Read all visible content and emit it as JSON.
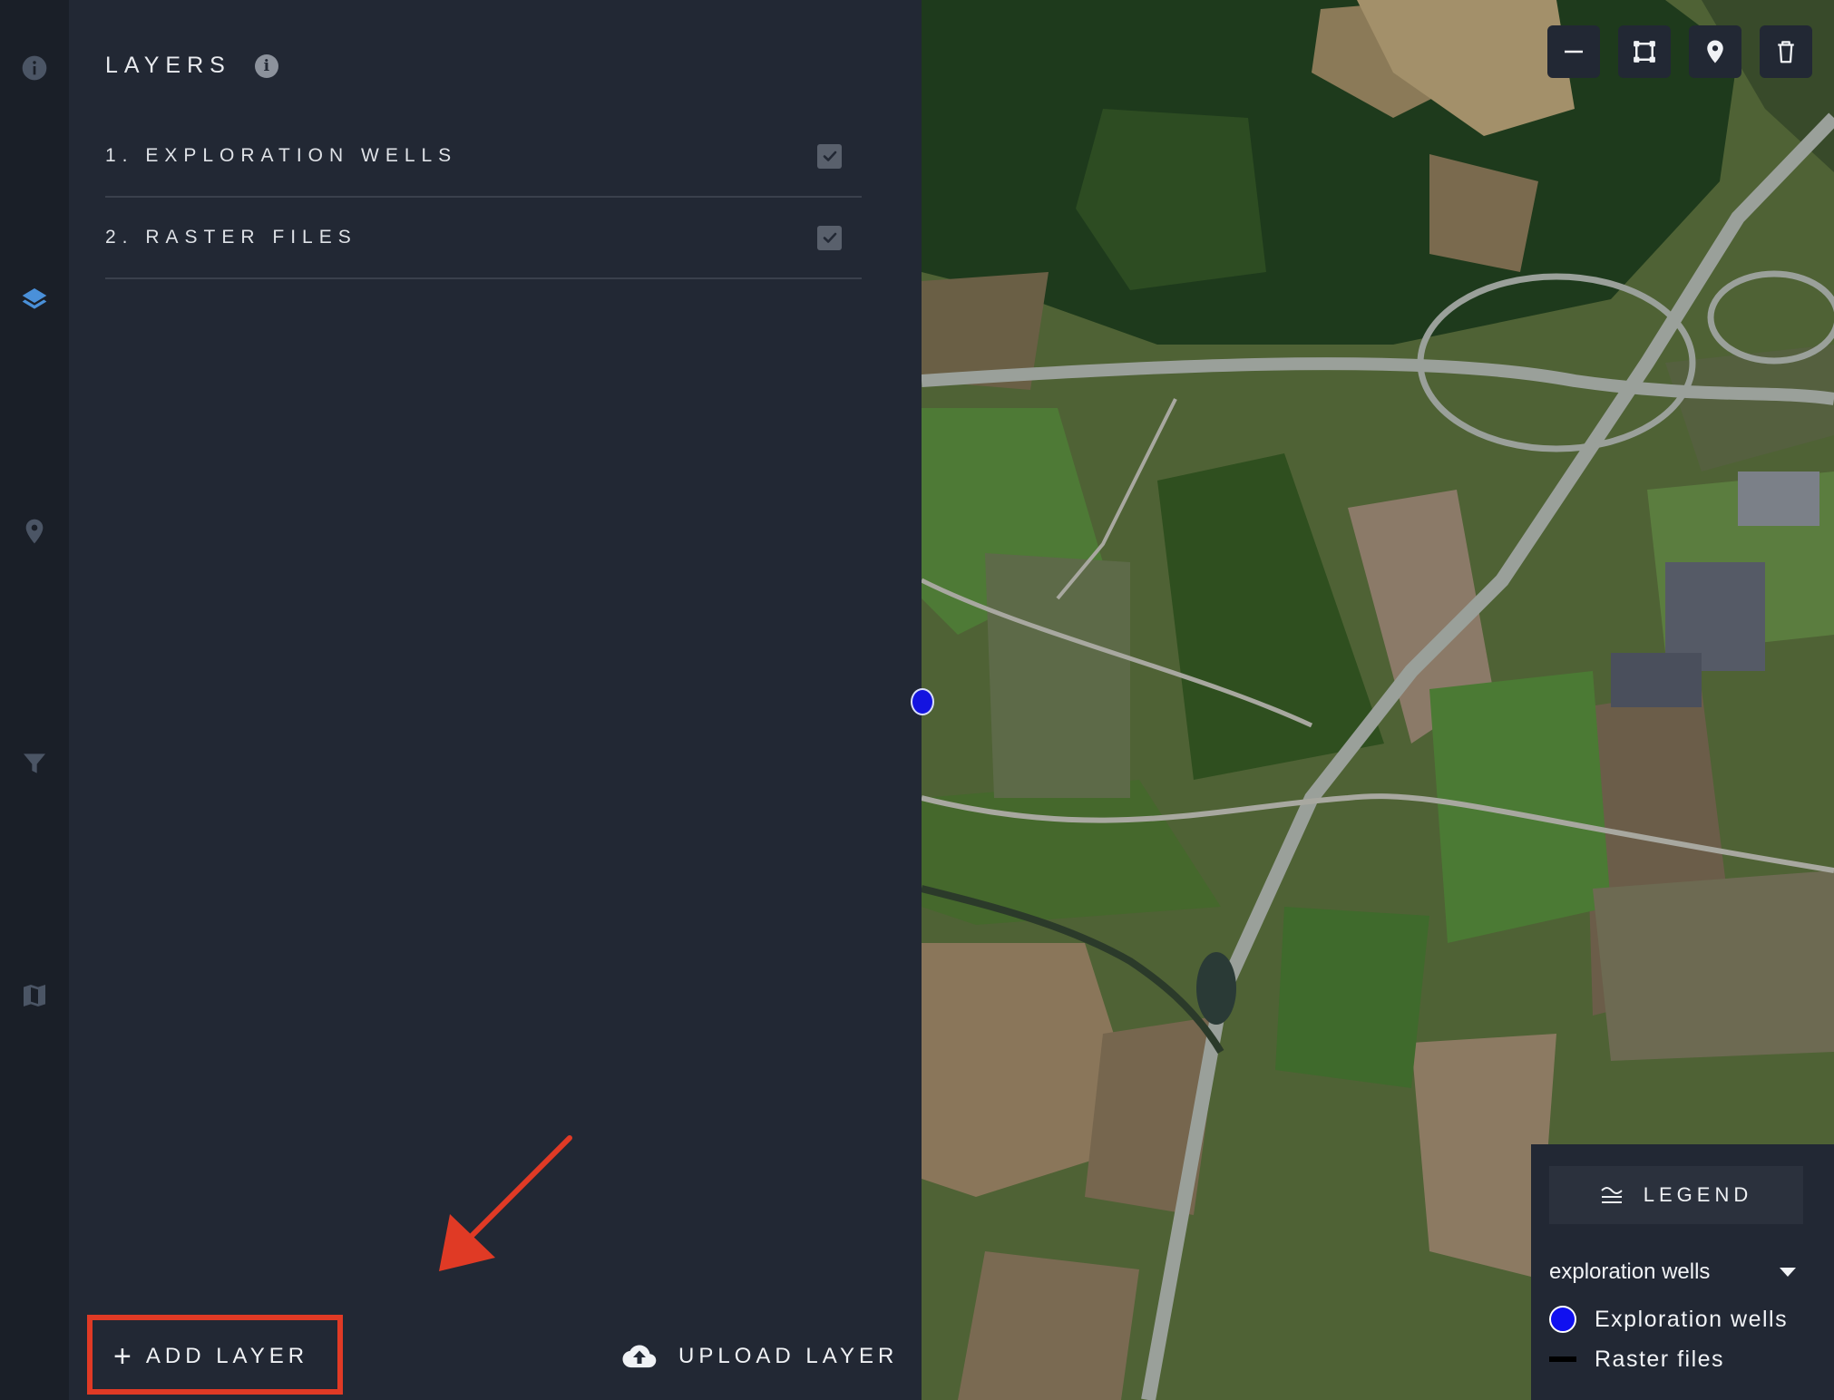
{
  "sidebar": {
    "rail": [
      {
        "name": "info",
        "icon": "info-icon",
        "active": false
      },
      {
        "name": "layers",
        "icon": "layers-icon",
        "active": true
      },
      {
        "name": "location",
        "icon": "map-pin-icon",
        "active": false
      },
      {
        "name": "filter",
        "icon": "filter-icon",
        "active": false
      },
      {
        "name": "basemap",
        "icon": "map-icon",
        "active": false
      }
    ]
  },
  "panel": {
    "title": "LAYERS",
    "info_glyph": "i",
    "layers": [
      {
        "label": "1. EXPLORATION WELLS",
        "checked": true
      },
      {
        "label": "2. RASTER FILES",
        "checked": true
      }
    ],
    "add_layer": {
      "icon": "+",
      "label": "ADD LAYER",
      "highlighted": true
    },
    "upload_layer": {
      "icon": "cloud-upload-icon",
      "label": "UPLOAD LAYER"
    }
  },
  "map": {
    "toolbar": [
      {
        "name": "line",
        "icon": "minus-line-icon"
      },
      {
        "name": "rectangle",
        "icon": "rectangle-select-icon"
      },
      {
        "name": "marker",
        "icon": "map-pin-icon"
      },
      {
        "name": "delete",
        "icon": "trash-icon"
      }
    ],
    "legend": {
      "title": "LEGEND",
      "selected_layer": "exploration wells",
      "items": [
        {
          "label": "Exploration wells",
          "symbol": "circle",
          "color": "#1010f0"
        },
        {
          "label": "Raster files",
          "symbol": "line",
          "color": "#000000"
        }
      ]
    }
  },
  "colors": {
    "accent": "#4a90d9",
    "highlight": "#e03a25",
    "panel_bg": "#222834",
    "rail_bg": "#1a1f28"
  }
}
